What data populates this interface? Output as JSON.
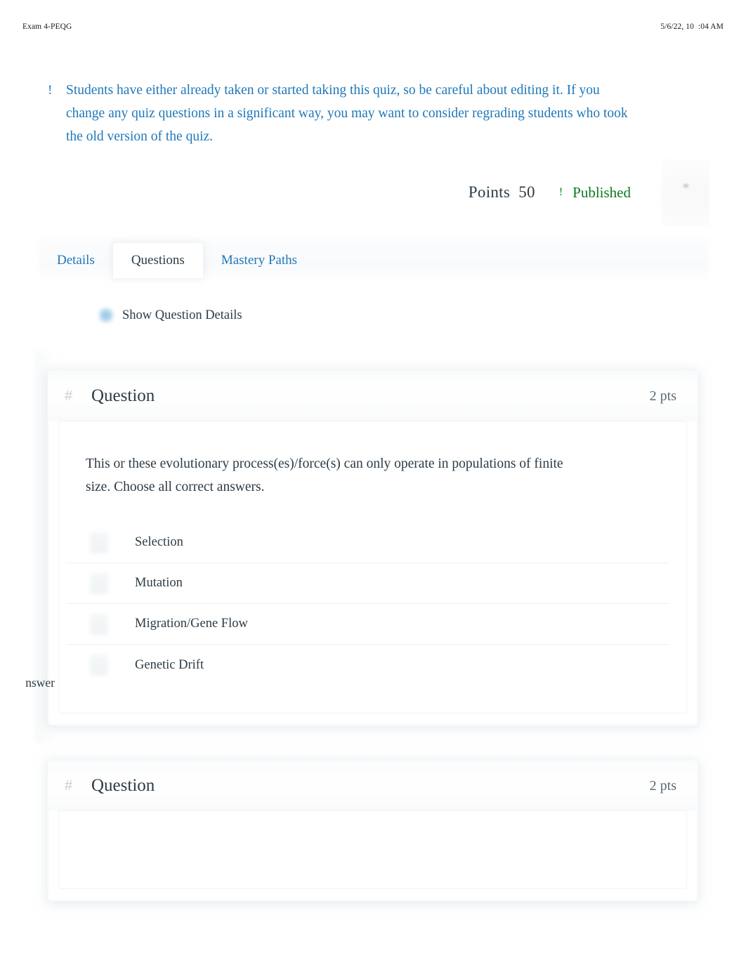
{
  "print_header": {
    "title": "Exam 4-PEQG",
    "date": "5/6/22, 10  :04 AM"
  },
  "warning": {
    "icon": "!",
    "icon_name": "warning-icon",
    "text": "Students have either already taken or started taking this quiz, so be careful about editing it. If you change any quiz questions in a significant way, you may want to consider regrading students who took the old version of the quiz.",
    "color": "#1f78b8"
  },
  "status": {
    "points_label": "Points",
    "points_value": "50",
    "points_combined": "Points  50",
    "published_icon": "!",
    "published_label": "Published",
    "published_color": "#0b7a1e",
    "ghost_button_mark": "\""
  },
  "tabs": [
    {
      "label": "Details",
      "active": false
    },
    {
      "label": "Questions",
      "active": true
    },
    {
      "label": "Mastery Paths",
      "active": false
    }
  ],
  "show_question_details": {
    "label": "Show Question Details",
    "checked": true
  },
  "questions": [
    {
      "hash_icon": "#",
      "title": "Question",
      "points": "2 pts",
      "text": "This or these evolutionary process(es)/force(s) can only operate in populations of finite size. Choose all correct answers.",
      "answers": [
        {
          "label": "Selection"
        },
        {
          "label": "Mutation"
        },
        {
          "label": "Migration/Gene Flow"
        },
        {
          "label": "Genetic Drift"
        }
      ]
    },
    {
      "hash_icon": "#",
      "title": "Question",
      "points": "2 pts",
      "text": "",
      "answers": []
    }
  ],
  "clipped_label": "nswer"
}
